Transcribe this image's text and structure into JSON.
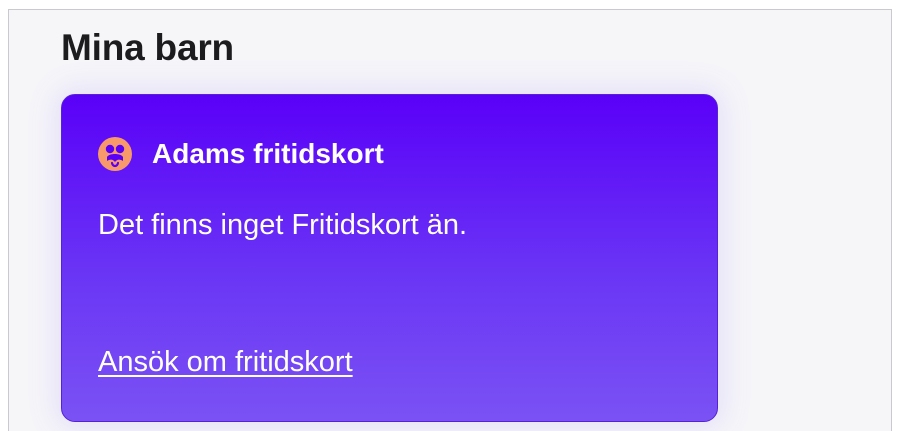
{
  "section": {
    "title": "Mina barn"
  },
  "card": {
    "icon": "child-face-icon",
    "title": "Adams fritidskort",
    "message": "Det finns inget Fritidskort än.",
    "link_label": "Ansök om fritidskort"
  },
  "colors": {
    "card_gradient_top": "#5a00f8",
    "card_gradient_bottom": "#7a52f4",
    "icon_background": "#f7996a",
    "page_background": "#f6f6f9"
  }
}
